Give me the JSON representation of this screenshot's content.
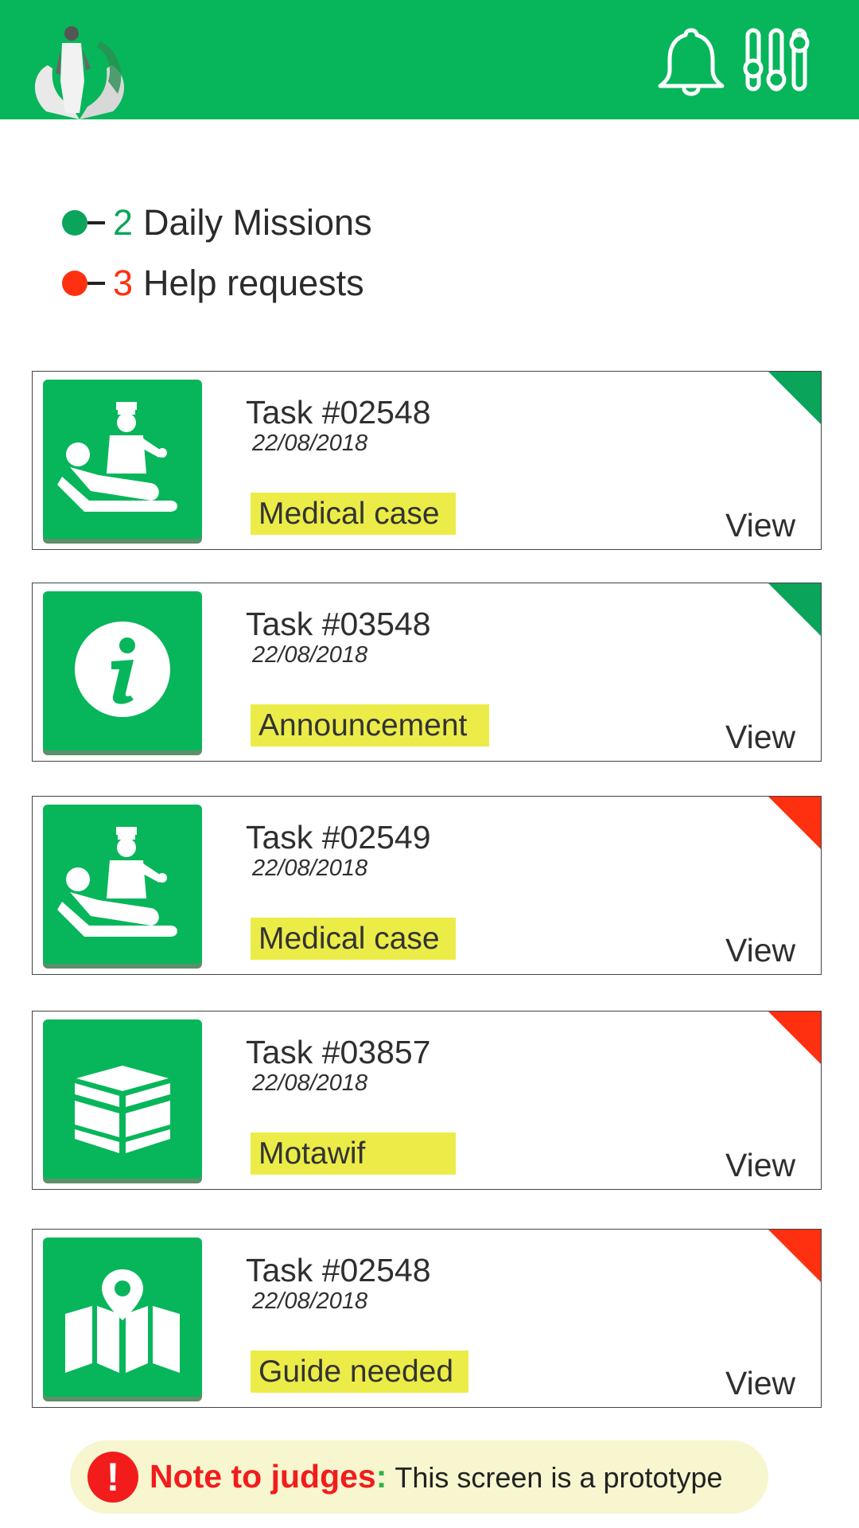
{
  "colors": {
    "primary": "#07b65a",
    "help": "#ff3010",
    "tag": "#ecec48",
    "note_bg": "#f7f6cf"
  },
  "header": {
    "logo_icon": "hands-holding-pilgrim-logo",
    "bell_icon": "bell-icon",
    "filter_icon": "sliders-icon"
  },
  "stats": [
    {
      "count": "2",
      "label": "Daily Missions",
      "color": "#0aa55a"
    },
    {
      "count": "3",
      "label": "Help requests",
      "color": "#ff3010"
    }
  ],
  "tasks": [
    {
      "title": "Task #02548",
      "date": "22/08/2018",
      "tag": "Medical case",
      "action": "View",
      "icon": "doctor-patient-icon",
      "status": "mission"
    },
    {
      "title": "Task #03548",
      "date": "22/08/2018",
      "tag": "Announcement",
      "action": "View",
      "icon": "info-icon",
      "status": "mission"
    },
    {
      "title": "Task #02549",
      "date": "22/08/2018",
      "tag": "Medical case",
      "action": "View",
      "icon": "doctor-patient-icon",
      "status": "help"
    },
    {
      "title": "Task #03857",
      "date": "22/08/2018",
      "tag": "Motawif",
      "action": "View",
      "icon": "kaaba-icon",
      "status": "help"
    },
    {
      "title": "Task #02548",
      "date": "22/08/2018",
      "tag": "Guide needed",
      "action": "View",
      "icon": "map-pin-icon",
      "status": "help"
    }
  ],
  "note": {
    "badge": "!",
    "label": "Note to judges",
    "colon": ":",
    "text": "This screen is  a prototype"
  }
}
